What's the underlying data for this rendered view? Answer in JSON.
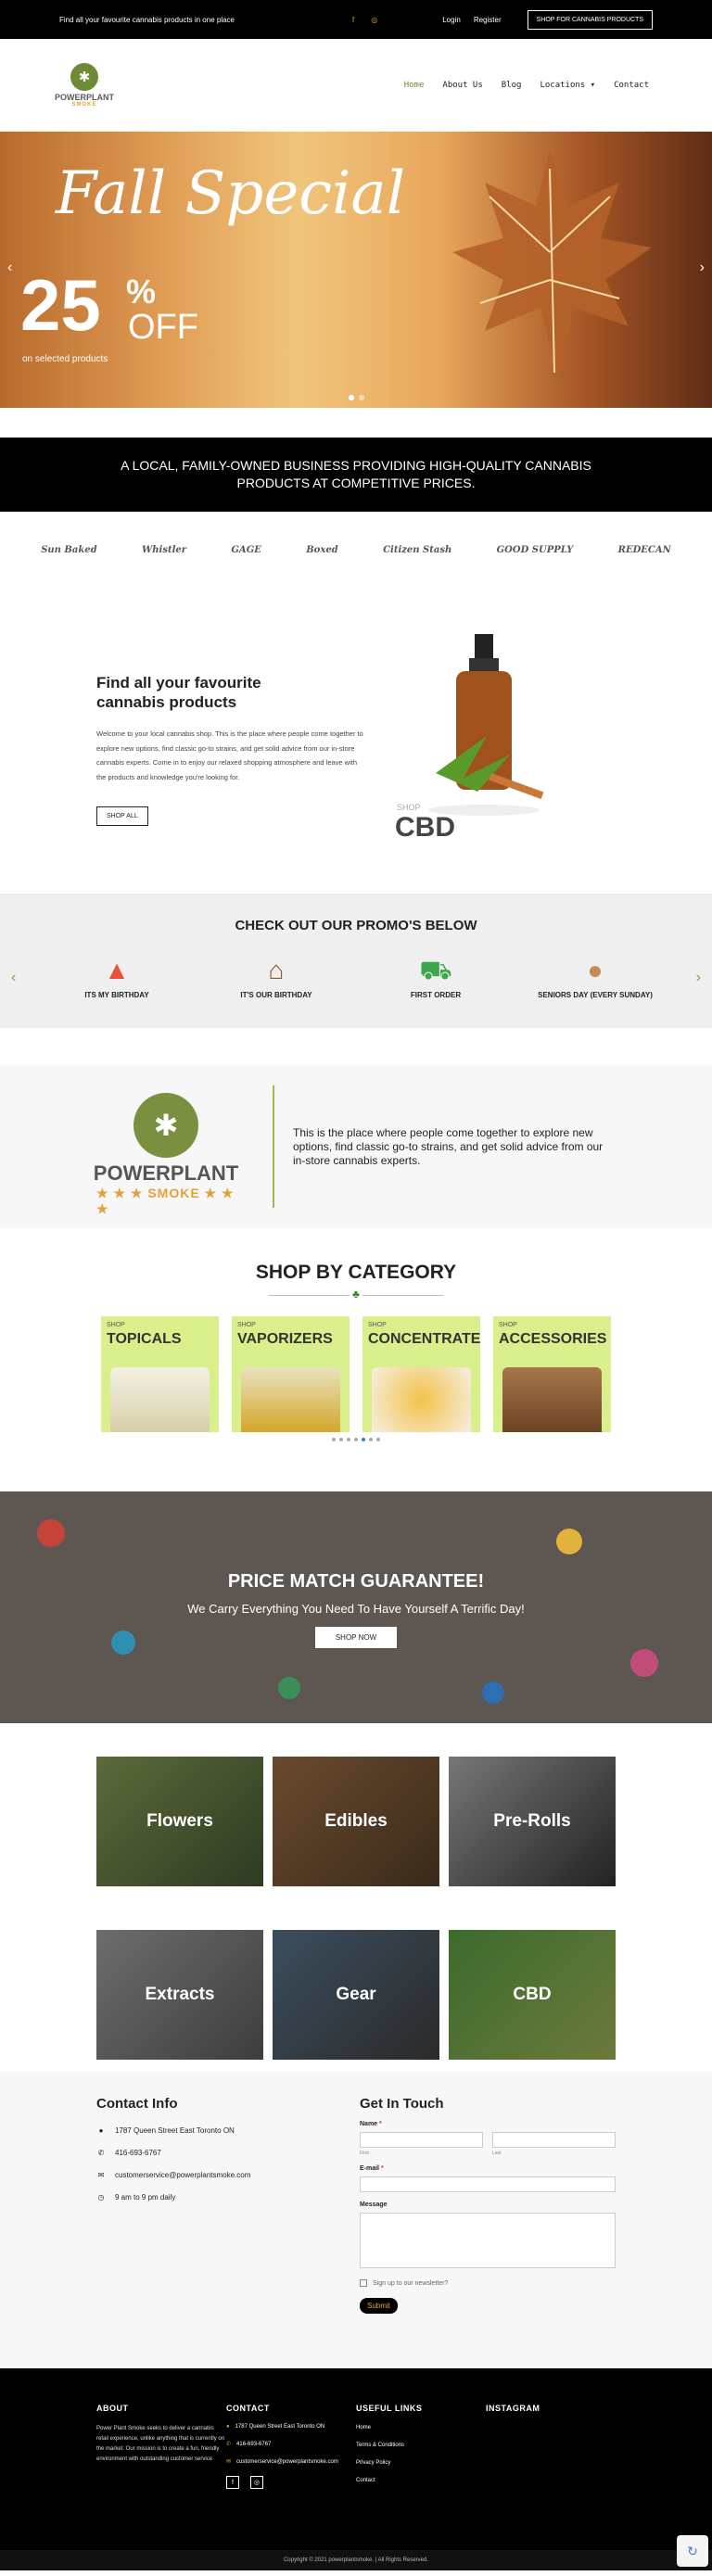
{
  "topbar": {
    "tagline": "Find all your favourite cannabis products in one place",
    "login": "Login",
    "register": "Register",
    "shop_button": "SHOP FOR CANNABIS PRODUCTS"
  },
  "logo": {
    "line1": "POWERPLANT",
    "line2": "SMOKE"
  },
  "nav": {
    "items": [
      "Home",
      "About Us",
      "Blog",
      "Locations ▾",
      "Contact"
    ]
  },
  "hero": {
    "title": "Fall Special",
    "percent": "25",
    "percent_sign": "%",
    "off": "OFF",
    "subtitle": "on selected products"
  },
  "mission": "A LOCAL, FAMILY-OWNED BUSINESS PROVIDING HIGH-QUALITY CANNABIS PRODUCTS AT COMPETITIVE PRICES.",
  "brands": [
    "Sun Baked",
    "Whistler",
    "GAGE",
    "Boxed",
    "Citizen Stash",
    "GOOD SUPPLY",
    "REDECAN"
  ],
  "intro": {
    "heading": "Find all your favourite cannabis products",
    "body": "Welcome to your local cannabis shop. This is the place where people come together to explore new options, find classic go-to strains, and get solid advice from our in-store cannabis experts. Come in to enjoy our relaxed shopping atmosphere and leave with the products and knowledge you're looking for.",
    "button": "SHOP ALL",
    "shop_label": "SHOP",
    "cbd_label": "CBD"
  },
  "promos": {
    "heading": "CHECK OUT OUR PROMO'S BELOW",
    "items": [
      {
        "label": "ITS MY BIRTHDAY",
        "icon": "party-hat-icon",
        "glyph": "▲"
      },
      {
        "label": "IT'S OUR BIRTHDAY",
        "icon": "cake-icon",
        "glyph": "⌂"
      },
      {
        "label": "FIRST ORDER",
        "icon": "cart-icon",
        "glyph": "⛟"
      },
      {
        "label": "SENIORS DAY (EVERY SUNDAY)",
        "icon": "seniors-badge-icon",
        "glyph": "●"
      }
    ]
  },
  "about": {
    "logo_line1": "POWERPLANT",
    "logo_line2": "★ ★ ★ SMOKE ★ ★ ★",
    "text": "This is the place where people come together to explore new options, find classic go-to strains, and get solid advice from our in-store cannabis experts."
  },
  "categories": {
    "heading": "SHOP BY CATEGORY",
    "items": [
      {
        "shop": "SHOP",
        "name": "TOPICALS"
      },
      {
        "shop": "SHOP",
        "name": "VAPORIZERS"
      },
      {
        "shop": "SHOP",
        "name": "CONCENTRATES"
      },
      {
        "shop": "SHOP",
        "name": "ACCESSORIES"
      }
    ]
  },
  "price_match": {
    "heading": "PRICE MATCH GUARANTEE!",
    "subheading": "We Carry Everything You Need To Have Yourself A Terrific Day!",
    "button": "SHOP NOW"
  },
  "tiles": [
    "Flowers",
    "Edibles",
    "Pre-Rolls",
    "Extracts",
    "Gear",
    "CBD"
  ],
  "contact_info": {
    "heading": "Contact Info",
    "address": "1787 Queen Street East Toronto ON",
    "phone": "416-693-6767",
    "email": "customerservice@powerplantsmoke.com",
    "hours": "9 am to 9 pm daily"
  },
  "form": {
    "heading": "Get In Touch",
    "name_label": "Name",
    "first_hint": "First",
    "last_hint": "Last",
    "email_label": "E-mail",
    "message_label": "Message",
    "newsletter": "Sign up to our newsletter?",
    "submit": "Submit"
  },
  "footer": {
    "about_heading": "ABOUT",
    "about_text": "Power Plant Smoke seeks to deliver a cannabis retail experience, unlike anything that is currently on the market. Our mission is to create a fun, friendly environment with outstanding customer service",
    "contact_heading": "CONTACT",
    "address": "1787 Queen Street East Toronto ON",
    "phone": "416-693-6767",
    "email": "customerservice@powerplantsmoke.com",
    "links_heading": "USEFUL LINKS",
    "links": [
      "Home",
      "Terms & Conditions",
      "Privacy Policy",
      "Contact"
    ],
    "instagram_heading": "INSTAGRAM",
    "copyright": "Copyright © 2021 powerplantsmoke. | All Rights Reserved."
  }
}
